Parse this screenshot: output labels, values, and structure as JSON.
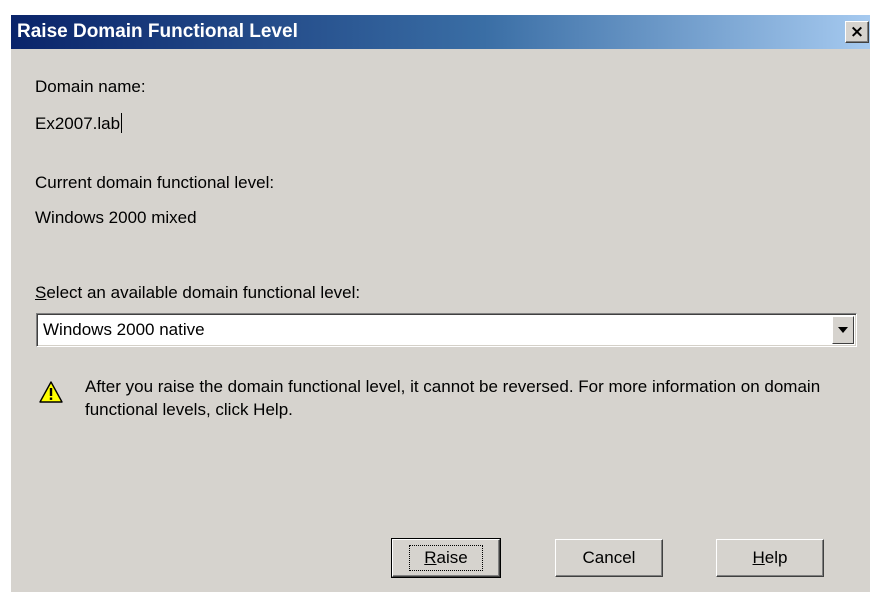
{
  "dialog": {
    "title": "Raise Domain Functional Level",
    "close_glyph": "×"
  },
  "domain": {
    "name_label": "Domain name:",
    "name_value": "Ex2007.lab"
  },
  "current_level": {
    "label": "Current domain functional level:",
    "value": "Windows 2000 mixed"
  },
  "select": {
    "label": "Select an available domain functional level:",
    "selected": "Windows 2000 native"
  },
  "warning": {
    "icon": "warning-icon",
    "text": "After you raise the domain functional level, it cannot be reversed. For more information on domain functional levels, click Help."
  },
  "buttons": {
    "raise": "Raise",
    "cancel": "Cancel",
    "help": "Help"
  },
  "colors": {
    "titlebar_start": "#0a246a",
    "titlebar_end": "#a6caf0",
    "dialog_bg": "#d6d3ce",
    "warning_yellow": "#ffff00"
  }
}
